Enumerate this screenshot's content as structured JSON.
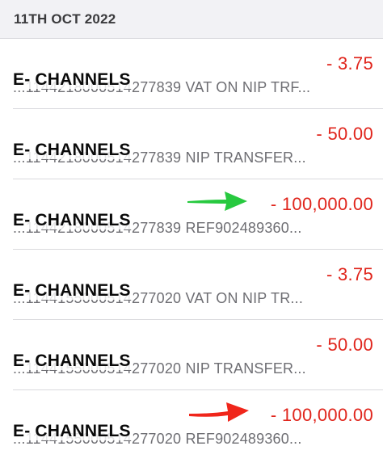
{
  "date_header": "11TH OCT 2022",
  "channel_label": "E- CHANNELS",
  "transactions": [
    {
      "amount": "- 3.75",
      "description": "...1144218000514277839 VAT ON NIP TRF..."
    },
    {
      "amount": "- 50.00",
      "description": "...1144218000514277839 NIP TRANSFER..."
    },
    {
      "amount": "- 100,000.00",
      "description": "...1144218000514277839 REF902489360..."
    },
    {
      "amount": "- 3.75",
      "description": "...1144155000514277020 VAT ON NIP TR..."
    },
    {
      "amount": "- 50.00",
      "description": "...1144155000514277020 NIP TRANSFER..."
    },
    {
      "amount": "- 100,000.00",
      "description": "...1144155000514277020 REF902489360..."
    }
  ],
  "colors": {
    "debit": "#e0241b",
    "green_arrow": "#27c93f",
    "red_arrow": "#f0261b"
  }
}
